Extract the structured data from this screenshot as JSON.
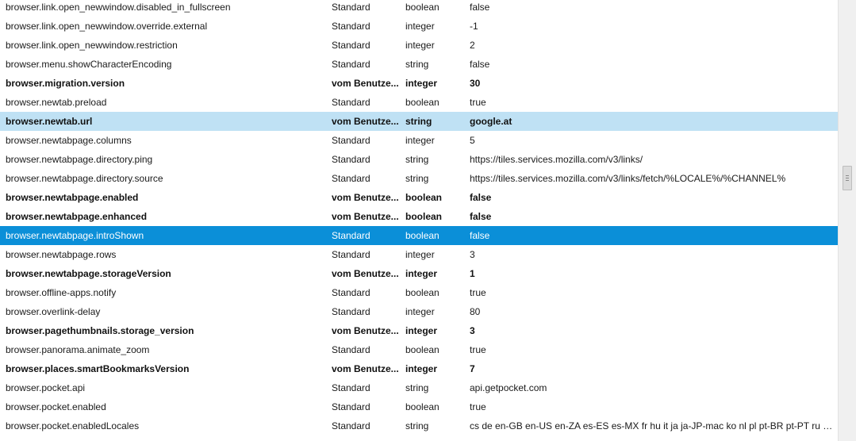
{
  "rows": [
    {
      "name": "browser.link.open_newwindow.disabled_in_fullscreen",
      "status": "Standard",
      "type": "boolean",
      "value": "false",
      "modified": false,
      "selected": ""
    },
    {
      "name": "browser.link.open_newwindow.override.external",
      "status": "Standard",
      "type": "integer",
      "value": "-1",
      "modified": false,
      "selected": ""
    },
    {
      "name": "browser.link.open_newwindow.restriction",
      "status": "Standard",
      "type": "integer",
      "value": "2",
      "modified": false,
      "selected": ""
    },
    {
      "name": "browser.menu.showCharacterEncoding",
      "status": "Standard",
      "type": "string",
      "value": "false",
      "modified": false,
      "selected": ""
    },
    {
      "name": "browser.migration.version",
      "status": "vom Benutze...",
      "type": "integer",
      "value": "30",
      "modified": true,
      "selected": ""
    },
    {
      "name": "browser.newtab.preload",
      "status": "Standard",
      "type": "boolean",
      "value": "true",
      "modified": false,
      "selected": ""
    },
    {
      "name": "browser.newtab.url",
      "status": "vom Benutze...",
      "type": "string",
      "value": "google.at",
      "modified": true,
      "selected": "light"
    },
    {
      "name": "browser.newtabpage.columns",
      "status": "Standard",
      "type": "integer",
      "value": "5",
      "modified": false,
      "selected": ""
    },
    {
      "name": "browser.newtabpage.directory.ping",
      "status": "Standard",
      "type": "string",
      "value": "https://tiles.services.mozilla.com/v3/links/",
      "modified": false,
      "selected": ""
    },
    {
      "name": "browser.newtabpage.directory.source",
      "status": "Standard",
      "type": "string",
      "value": "https://tiles.services.mozilla.com/v3/links/fetch/%LOCALE%/%CHANNEL%",
      "modified": false,
      "selected": ""
    },
    {
      "name": "browser.newtabpage.enabled",
      "status": "vom Benutze...",
      "type": "boolean",
      "value": "false",
      "modified": true,
      "selected": ""
    },
    {
      "name": "browser.newtabpage.enhanced",
      "status": "vom Benutze...",
      "type": "boolean",
      "value": "false",
      "modified": true,
      "selected": ""
    },
    {
      "name": "browser.newtabpage.introShown",
      "status": "Standard",
      "type": "boolean",
      "value": "false",
      "modified": false,
      "selected": "active"
    },
    {
      "name": "browser.newtabpage.rows",
      "status": "Standard",
      "type": "integer",
      "value": "3",
      "modified": false,
      "selected": ""
    },
    {
      "name": "browser.newtabpage.storageVersion",
      "status": "vom Benutze...",
      "type": "integer",
      "value": "1",
      "modified": true,
      "selected": ""
    },
    {
      "name": "browser.offline-apps.notify",
      "status": "Standard",
      "type": "boolean",
      "value": "true",
      "modified": false,
      "selected": ""
    },
    {
      "name": "browser.overlink-delay",
      "status": "Standard",
      "type": "integer",
      "value": "80",
      "modified": false,
      "selected": ""
    },
    {
      "name": "browser.pagethumbnails.storage_version",
      "status": "vom Benutze...",
      "type": "integer",
      "value": "3",
      "modified": true,
      "selected": ""
    },
    {
      "name": "browser.panorama.animate_zoom",
      "status": "Standard",
      "type": "boolean",
      "value": "true",
      "modified": false,
      "selected": ""
    },
    {
      "name": "browser.places.smartBookmarksVersion",
      "status": "vom Benutze...",
      "type": "integer",
      "value": "7",
      "modified": true,
      "selected": ""
    },
    {
      "name": "browser.pocket.api",
      "status": "Standard",
      "type": "string",
      "value": "api.getpocket.com",
      "modified": false,
      "selected": ""
    },
    {
      "name": "browser.pocket.enabled",
      "status": "Standard",
      "type": "boolean",
      "value": "true",
      "modified": false,
      "selected": ""
    },
    {
      "name": "browser.pocket.enabledLocales",
      "status": "Standard",
      "type": "string",
      "value": "cs de en-GB en-US en-ZA es-ES es-MX fr hu it ja ja-JP-mac ko nl pl pt-BR pt-PT ru zh-...",
      "modified": false,
      "selected": ""
    }
  ],
  "colors": {
    "selected_light": "#bfe1f4",
    "selected_active": "#0b8fd8"
  }
}
